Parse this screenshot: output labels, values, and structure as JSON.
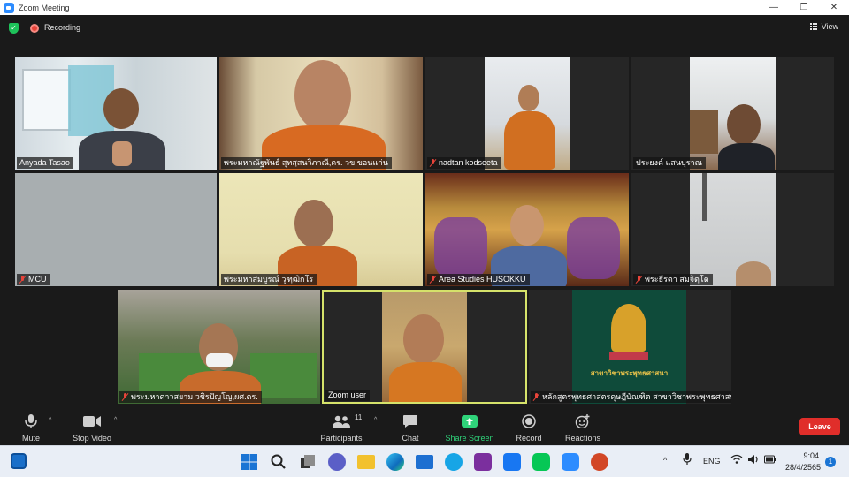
{
  "window": {
    "title": "Zoom Meeting"
  },
  "topbar": {
    "recording_label": "Recording",
    "view_label": "View"
  },
  "participants": [
    {
      "name": "Anyada Tasao",
      "muted": false
    },
    {
      "name": "พระมหาณัฐพันธ์ สุทสฺสนวิภาณี,ดร. วข.ขอนแก่น",
      "muted": false
    },
    {
      "name": "nadtan kodseeta",
      "muted": true
    },
    {
      "name": "ประยงค์ แสนบุราณ",
      "muted": false
    },
    {
      "name": "MCU",
      "muted": true
    },
    {
      "name": "พระมหาสมบูรณ์ วุฑฺฒิกโร",
      "muted": false
    },
    {
      "name": "Area Studies HUSOKKU",
      "muted": true
    },
    {
      "name": "พระธีรตา สมจิตฺโต",
      "muted": true
    },
    {
      "name": "พระมหาดาวสยาม วชิรปัญโญ,ผศ.ดร.",
      "muted": true
    },
    {
      "name": "Zoom user",
      "muted": false
    },
    {
      "name": "หลักสูตรพุทธศาสตรดุษฎีบัณฑิต สาขาวิชาพระพุทธศาสน...",
      "muted": true
    }
  ],
  "logo_tile": {
    "caption": "สาขาวิชาพระพุทธศาสนา"
  },
  "toolbar": {
    "mute": "Mute",
    "stop_video": "Stop Video",
    "participants": "Participants",
    "participants_count": "11",
    "chat": "Chat",
    "share_screen": "Share Screen",
    "record": "Record",
    "reactions": "Reactions",
    "leave": "Leave"
  },
  "taskbar": {
    "language": "ENG",
    "time": "9:04",
    "date": "28/4/2565",
    "notification_count": "1"
  },
  "colors": {
    "accent": "#2d8cff",
    "share": "#2fd37a",
    "leave": "#e02e2a",
    "active_speaker": "#d5e26a"
  }
}
